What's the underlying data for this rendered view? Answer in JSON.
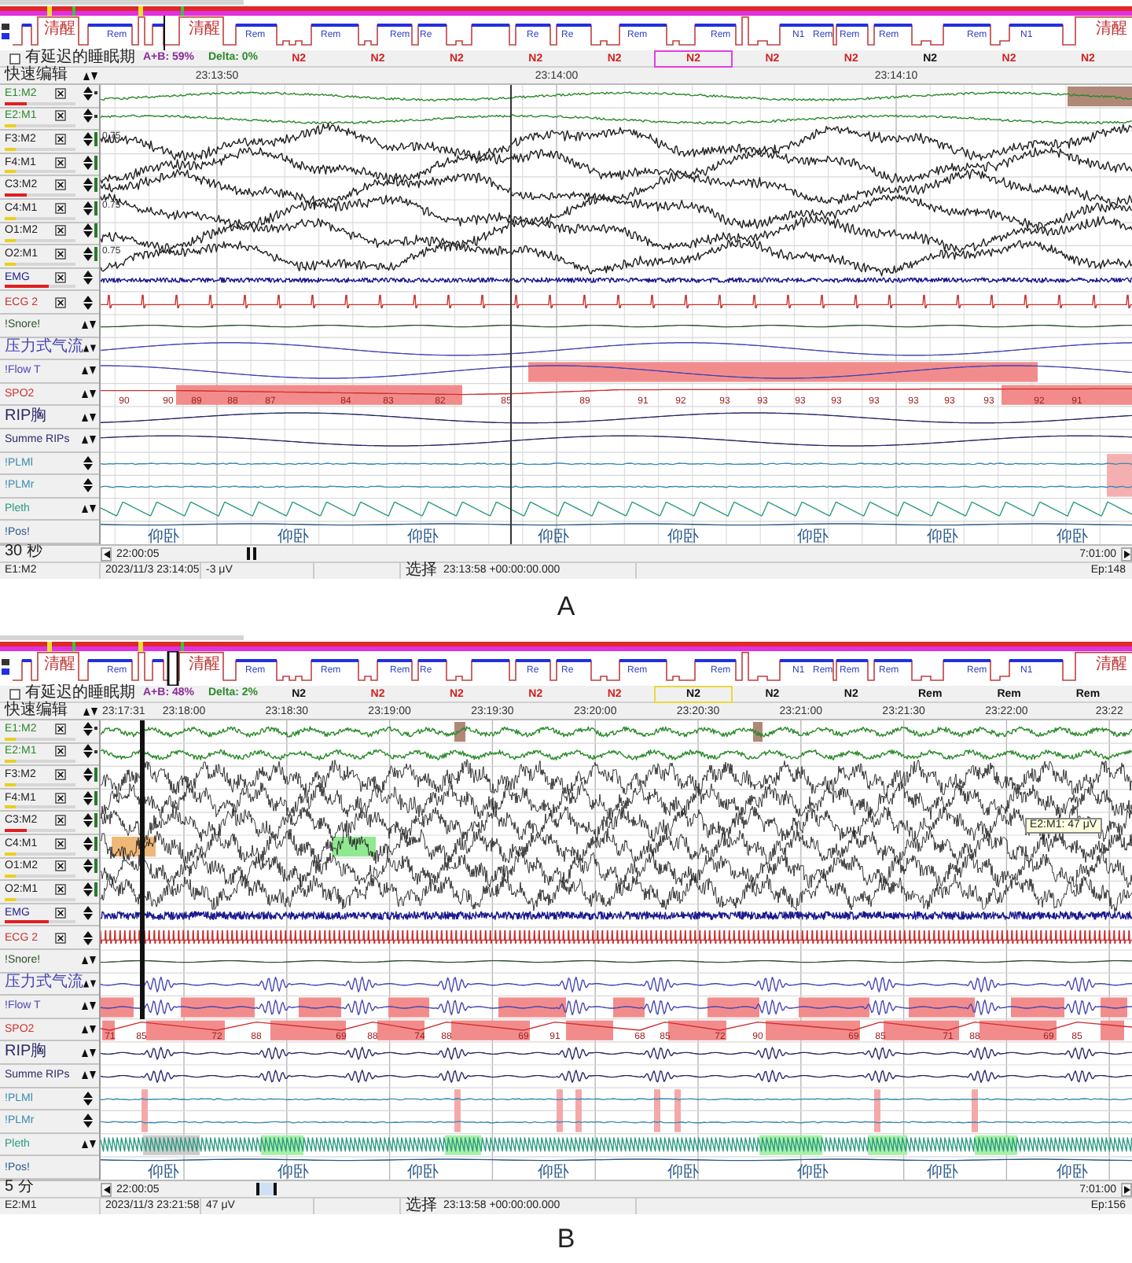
{
  "panels": [
    {
      "caption": "A",
      "selection_box": {
        "color": "#e040e0"
      },
      "hypnogram_labels": [
        "清醒",
        "Rem",
        "清醒",
        "Rem",
        "Rem",
        "Rem",
        "Re",
        "Re",
        "Re",
        "Rem",
        "Rem",
        "N1",
        "Rem",
        "Rem",
        "Rem",
        "Rem",
        "N1",
        "清醒"
      ],
      "delay_option": {
        "label": "有延迟的睡眠期",
        "checked": false
      },
      "ab_ratio": "A+B: 59%",
      "delta": "Delta: 0%",
      "stages": [
        {
          "label": "N2",
          "color": "#d02020",
          "selected": false
        },
        {
          "label": "N2",
          "color": "#d02020",
          "selected": false
        },
        {
          "label": "N2",
          "color": "#d02020",
          "selected": false
        },
        {
          "label": "N2",
          "color": "#d02020",
          "selected": false
        },
        {
          "label": "N2",
          "color": "#d02020",
          "selected": false
        },
        {
          "label": "N2",
          "color": "#d02020",
          "selected": true
        },
        {
          "label": "N2",
          "color": "#d02020",
          "selected": false
        },
        {
          "label": "N2",
          "color": "#d02020",
          "selected": false
        },
        {
          "label": "N2",
          "color": "#111111",
          "selected": false
        },
        {
          "label": "N2",
          "color": "#d02020",
          "selected": false
        },
        {
          "label": "N2",
          "color": "#d02020",
          "selected": false
        }
      ],
      "quick_edit": "快速编辑",
      "times": [
        "23:13:50",
        "23:14:00",
        "23:14:10"
      ],
      "channels": [
        {
          "name": "E1:M2",
          "kind": "eog",
          "color": "#2a8a2a",
          "checked": true,
          "meter": {
            "level": 0.3,
            "color": "#e02020"
          }
        },
        {
          "name": "E2:M1",
          "kind": "eog",
          "color": "#2a8a2a",
          "checked": true,
          "meter": {
            "level": 0.15,
            "color": "#e8d020"
          }
        },
        {
          "name": "F3:M2",
          "kind": "eeg",
          "color": "#222222",
          "checked": true,
          "meter": {
            "level": 0.15,
            "color": "#e8d020"
          },
          "readings": [
            "0.75"
          ]
        },
        {
          "name": "F4:M1",
          "kind": "eeg",
          "color": "#222222",
          "checked": true,
          "meter": {
            "level": 0.15,
            "color": "#e8d020"
          }
        },
        {
          "name": "C3:M2",
          "kind": "eeg",
          "color": "#222222",
          "checked": true,
          "meter": {
            "level": 0.3,
            "color": "#e02020"
          }
        },
        {
          "name": "C4:M1",
          "kind": "eeg",
          "color": "#222222",
          "checked": true,
          "meter": {
            "level": 0.15,
            "color": "#e8d020"
          },
          "readings": [
            "0.75"
          ]
        },
        {
          "name": "O1:M2",
          "kind": "eeg",
          "color": "#222222",
          "checked": true,
          "meter": {
            "level": 0.15,
            "color": "#e8d020"
          }
        },
        {
          "name": "O2:M1",
          "kind": "eeg",
          "color": "#222222",
          "checked": true,
          "meter": {
            "level": 0.15,
            "color": "#e8d020"
          },
          "readings": [
            "0.75"
          ]
        },
        {
          "name": "EMG",
          "kind": "emg",
          "color": "#1a1a90",
          "checked": true,
          "meter": {
            "level": 0.62,
            "color": "#e02020"
          }
        },
        {
          "name": "ECG 2",
          "kind": "ecg",
          "color": "#c83030",
          "checked": true
        },
        {
          "name": "!Snore!",
          "kind": "snore",
          "color": "#2d4f2d"
        },
        {
          "name": "压力式气流",
          "kind": "flow",
          "color": "#4646b4"
        },
        {
          "name": "!Flow T",
          "kind": "flow",
          "color": "#4646b4"
        },
        {
          "name": "SPO2",
          "kind": "spo2",
          "color": "#d03030",
          "readings": [
            "90",
            "90",
            "89",
            "88",
            "87",
            "84",
            "83",
            "82",
            "85",
            "89",
            "91",
            "92",
            "93",
            "93",
            "93",
            "93",
            "93",
            "93",
            "93",
            "93",
            "92",
            "91"
          ]
        },
        {
          "name": "RIP胸",
          "kind": "effort",
          "color": "#2a2a6a"
        },
        {
          "name": "Summe RIPs",
          "kind": "effort",
          "color": "#2a2a6a"
        },
        {
          "name": "!PLMl",
          "kind": "limb",
          "color": "#3a8ab0"
        },
        {
          "name": "!PLMr",
          "kind": "limb",
          "color": "#3a8ab0"
        },
        {
          "name": "Pleth",
          "kind": "pleth",
          "color": "#2a9a80"
        },
        {
          "name": "!Pos!",
          "kind": "position",
          "color": "#2a5a8a",
          "readings": [
            "仰卧",
            "仰卧",
            "仰卧",
            "仰卧",
            "仰卧",
            "仰卧",
            "仰卧",
            "仰卧"
          ]
        }
      ],
      "page_length": "30 秒",
      "start_time": "22:00:05",
      "end_time": "7:01:00",
      "status_bar": {
        "channel": "E1:M2",
        "datetime": "2023/11/3 23:14:05",
        "value": "-3 μV",
        "selection_label": "选择",
        "selection": "23:13:58 +00:00:00.000",
        "epoch": "Ep:148"
      }
    },
    {
      "caption": "B",
      "selection_box": {
        "color": "#e8d840"
      },
      "hypnogram_labels": [
        "清醒",
        "Rem",
        "清醒",
        "Rem",
        "Rem",
        "Rem",
        "Re",
        "Re",
        "Re",
        "Rem",
        "Rem",
        "N1",
        "Rem",
        "Rem",
        "Rem",
        "Rem",
        "N1",
        "清醒"
      ],
      "delay_option": {
        "label": "有延迟的睡眠期",
        "checked": false
      },
      "ab_ratio": "A+B: 48%",
      "delta": "Delta: 2%",
      "stages": [
        {
          "label": "N2",
          "color": "#111111",
          "selected": false
        },
        {
          "label": "N2",
          "color": "#d02020",
          "selected": false
        },
        {
          "label": "N2",
          "color": "#d02020",
          "selected": false
        },
        {
          "label": "N2",
          "color": "#d02020",
          "selected": false
        },
        {
          "label": "N2",
          "color": "#d02020",
          "selected": false
        },
        {
          "label": "N2",
          "color": "#111111",
          "selected": true
        },
        {
          "label": "N2",
          "color": "#111111",
          "selected": false
        },
        {
          "label": "N2",
          "color": "#111111",
          "selected": false
        },
        {
          "label": "Rem",
          "color": "#111111",
          "selected": false
        },
        {
          "label": "Rem",
          "color": "#111111",
          "selected": false
        },
        {
          "label": "Rem",
          "color": "#111111",
          "selected": false
        }
      ],
      "quick_edit": "快速编辑",
      "times": [
        "23:17:31",
        "23:18:00",
        "23:18:30",
        "23:19:00",
        "23:19:30",
        "23:20:00",
        "23:20:30",
        "23:21:00",
        "23:21:30",
        "23:22:00",
        "23:22"
      ],
      "channels": [
        {
          "name": "E1:M2",
          "kind": "eog",
          "color": "#2a8a2a",
          "checked": true,
          "meter": {
            "level": 0.15,
            "color": "#e8d020"
          }
        },
        {
          "name": "E2:M1",
          "kind": "eog",
          "color": "#2a8a2a",
          "checked": true,
          "meter": {
            "level": 0.15,
            "color": "#e8d020"
          }
        },
        {
          "name": "F3:M2",
          "kind": "eeg",
          "color": "#222222",
          "checked": true,
          "meter": {
            "level": 0.15,
            "color": "#e8d020"
          }
        },
        {
          "name": "F4:M1",
          "kind": "eeg",
          "color": "#222222",
          "checked": true,
          "meter": {
            "level": 0.15,
            "color": "#e8d020"
          }
        },
        {
          "name": "C3:M2",
          "kind": "eeg",
          "color": "#222222",
          "checked": true,
          "meter": {
            "level": 0.3,
            "color": "#e02020"
          }
        },
        {
          "name": "C4:M1",
          "kind": "eeg",
          "color": "#222222",
          "checked": true,
          "meter": {
            "level": 0.15,
            "color": "#e8d020"
          }
        },
        {
          "name": "O1:M2",
          "kind": "eeg",
          "color": "#222222",
          "checked": true,
          "meter": {
            "level": 0.15,
            "color": "#e8d020"
          }
        },
        {
          "name": "O2:M1",
          "kind": "eeg",
          "color": "#222222",
          "checked": true,
          "meter": {
            "level": 0.15,
            "color": "#e8d020"
          }
        },
        {
          "name": "EMG",
          "kind": "emg",
          "color": "#1a1a90",
          "checked": true,
          "meter": {
            "level": 0.62,
            "color": "#e02020"
          }
        },
        {
          "name": "ECG 2",
          "kind": "ecg",
          "color": "#c83030",
          "checked": true
        },
        {
          "name": "!Snore!",
          "kind": "snore",
          "color": "#2d4f2d"
        },
        {
          "name": "压力式气流",
          "kind": "flow",
          "color": "#4646b4"
        },
        {
          "name": "!Flow T",
          "kind": "flow",
          "color": "#4646b4"
        },
        {
          "name": "SPO2",
          "kind": "spo2",
          "color": "#d03030",
          "readings": [
            "71",
            "85",
            "72",
            "88",
            "69",
            "88",
            "74",
            "88",
            "69",
            "91",
            "68",
            "85",
            "72",
            "90",
            "69",
            "85",
            "71",
            "88",
            "69",
            "85"
          ]
        },
        {
          "name": "RIP胸",
          "kind": "effort",
          "color": "#2a2a6a"
        },
        {
          "name": "Summe RIPs",
          "kind": "effort",
          "color": "#2a2a6a"
        },
        {
          "name": "!PLMl",
          "kind": "limb",
          "color": "#3a8ab0"
        },
        {
          "name": "!PLMr",
          "kind": "limb",
          "color": "#3a8ab0"
        },
        {
          "name": "Pleth",
          "kind": "pleth",
          "color": "#2a9a80"
        },
        {
          "name": "!Pos!",
          "kind": "position",
          "color": "#2a5a8a",
          "readings": [
            "仰卧",
            "仰卧",
            "仰卧",
            "仰卧",
            "仰卧",
            "仰卧",
            "仰卧",
            "仰卧"
          ]
        }
      ],
      "tooltip": "E2:M1: 47 μV",
      "page_length": "5 分",
      "start_time": "22:00:05",
      "end_time": "7:01:00",
      "status_bar": {
        "channel": "E2:M1",
        "datetime": "2023/11/3 23:21:58",
        "value": "47 μV",
        "selection_label": "选择",
        "selection": "23:13:58 +00:00:00.000",
        "epoch": "Ep:156"
      }
    }
  ]
}
